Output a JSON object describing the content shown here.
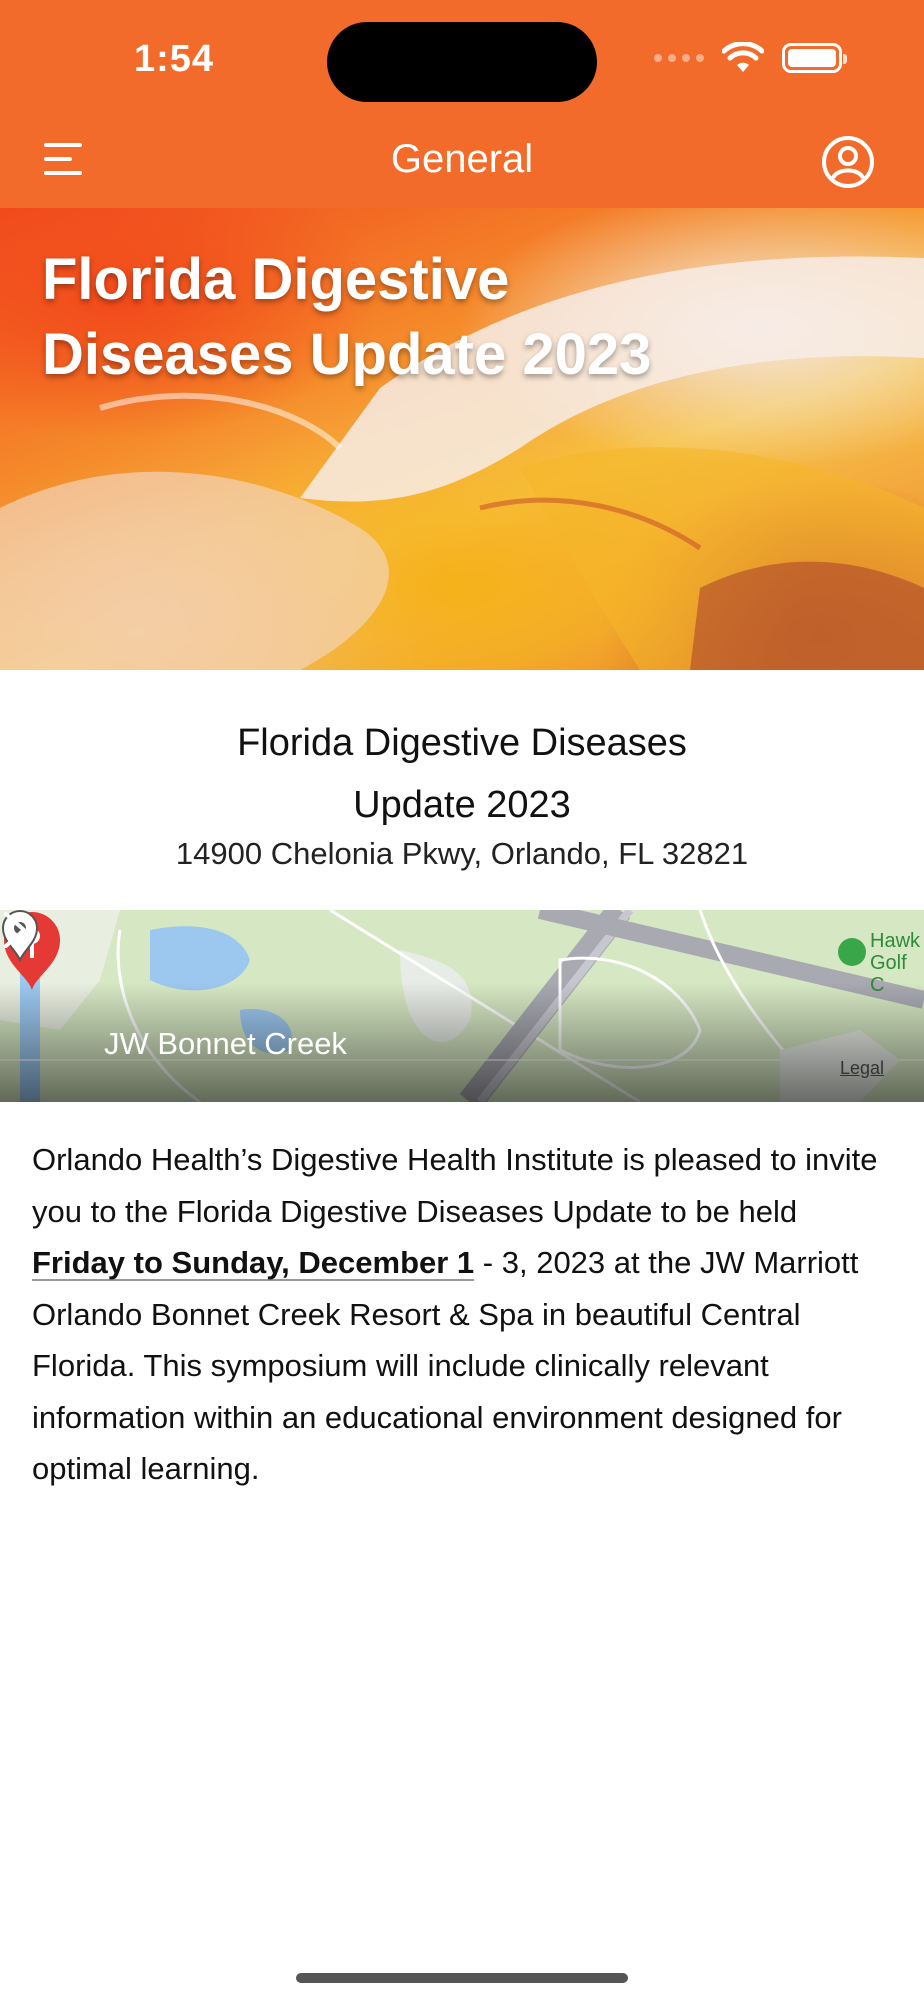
{
  "status_bar": {
    "time": "1:54"
  },
  "nav": {
    "title": "General"
  },
  "banner": {
    "title": "Florida Digestive Diseases Update 2023"
  },
  "event": {
    "title_line1": "Florida Digestive Diseases",
    "title_line2": "Update 2023",
    "address": "14900 Chelonia Pkwy, Orlando, FL 32821"
  },
  "map": {
    "location_label": "JW Bonnet Creek",
    "legal": "Legal",
    "poi_line1": "Hawk",
    "poi_line2": "Golf C"
  },
  "description": {
    "part1": "Orlando Health’s Digestive Health Institute is pleased to invite you to the Florida Digestive Diseases Update to be held ",
    "date_link": "Friday to Sunday, December 1",
    "part2": " - 3, 2023 at the JW Marriott Orlando Bonnet Creek Resort & Spa in beautiful Central Florida. This symposium will include clinically relevant information within an educational environment designed for optimal learning."
  },
  "colors": {
    "header": "#F26B2A",
    "map_pin": "#E53935"
  },
  "icons": {
    "menu": "menu-icon",
    "profile": "profile-icon",
    "location": "location-pin-icon",
    "chevron": "chevron-right-icon",
    "wifi": "wifi-icon",
    "battery": "battery-icon"
  }
}
